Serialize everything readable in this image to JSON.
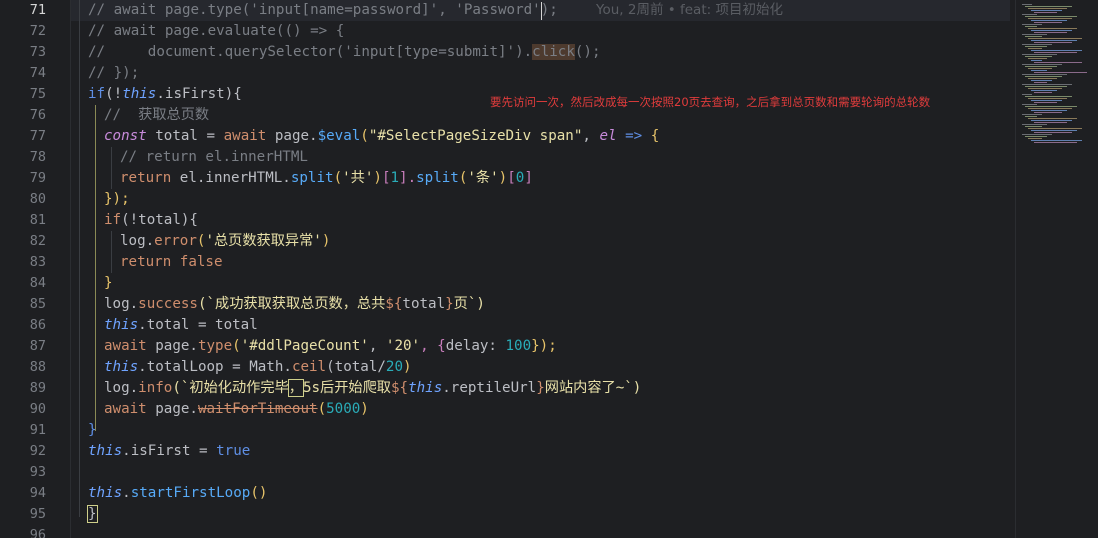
{
  "editor": {
    "blame": "You, 2周前 • feat: 项目初始化",
    "annotation": "要先访问一次，然后改成每一次按照20页去查询，之后拿到总页数和需要轮询的总轮数",
    "line_numbers": [
      "71",
      "72",
      "73",
      "74",
      "75",
      "76",
      "77",
      "78",
      "79",
      "80",
      "81",
      "82",
      "83",
      "84",
      "85",
      "86",
      "87",
      "88",
      "89",
      "90",
      "91",
      "92",
      "93",
      "94",
      "95",
      "96"
    ],
    "current_line": "71",
    "code": {
      "l71": [
        "// await page.type('input[name=password]', 'Password');"
      ],
      "l72": [
        "// await page.evaluate(() => {"
      ],
      "l73": [
        "//     document.querySelector('input[type=submit]').",
        "click",
        "();"
      ],
      "l74": [
        "// });"
      ],
      "l75": [
        "if",
        "(!",
        "this",
        ".isFirst){"
      ],
      "l76": [
        "//  获取总页数"
      ],
      "l77": [
        "const",
        " total ",
        "=",
        " ",
        "await",
        " page.",
        "$eval",
        "(",
        "\"#SelectPageSizeDiv span\"",
        ", ",
        "el",
        " ",
        "=>",
        " {"
      ],
      "l78": [
        "// return el.innerHTML"
      ],
      "l79": [
        "return",
        " el.innerHTML.",
        "split",
        "(",
        "'共'",
        ")",
        "[",
        "1",
        "].",
        "split",
        "(",
        "'条'",
        ")",
        "[",
        "0",
        "]"
      ],
      "l80": [
        "});"
      ],
      "l81": [
        "if",
        "(!total){"
      ],
      "l82": [
        "log.",
        "error",
        "(",
        "'总页数获取异常'",
        ")"
      ],
      "l83": [
        "return",
        " ",
        "false"
      ],
      "l84": [
        "}"
      ],
      "l85": [
        "log.",
        "success",
        "(`成功获取获取总页数，总共",
        "${",
        "total",
        "}",
        "页`)"
      ],
      "l86": [
        "this",
        ".total ",
        "=",
        " total"
      ],
      "l87": [
        "await",
        " page.",
        "type",
        "(",
        "'#ddlPageCount'",
        ", ",
        "'20'",
        ", {",
        "delay",
        ": ",
        "100",
        "});"
      ],
      "l88": [
        "this",
        ".totalLoop ",
        "=",
        " Math.",
        "ceil",
        "(total",
        "/",
        "20",
        ")"
      ],
      "l89": [
        "log.",
        "info",
        "(`初始化动作完毕",
        "，",
        "5s后开始爬取",
        "${",
        "this",
        ".reptileUrl",
        "}",
        "网站内容了~`)"
      ],
      "l90": [
        "await",
        " page.",
        "waitForTimeout",
        "(",
        "5000",
        ")"
      ],
      "l91": [
        "}"
      ],
      "l92": [
        "this",
        ".isFirst ",
        "=",
        " ",
        "true"
      ],
      "l93": [
        ""
      ],
      "l94": [
        "this",
        ".",
        "startFirstLoop",
        "()"
      ],
      "l95": [
        "}"
      ],
      "l96": [
        ""
      ]
    }
  }
}
